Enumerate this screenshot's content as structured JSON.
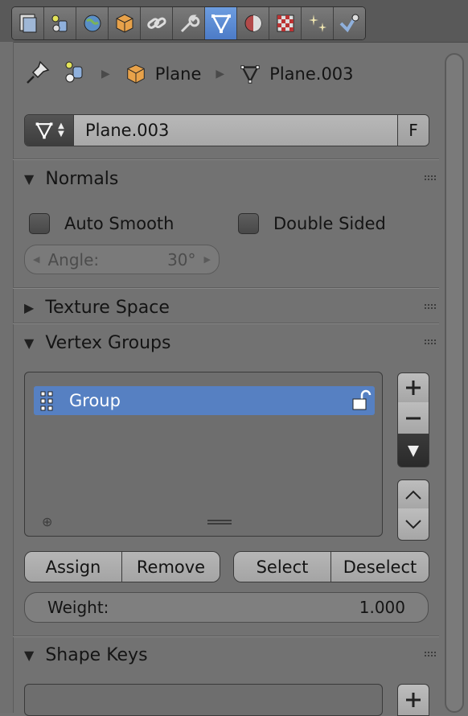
{
  "tabs": [
    {
      "icon": "render-layers-icon"
    },
    {
      "icon": "scene-icon"
    },
    {
      "icon": "world-icon"
    },
    {
      "icon": "object-icon"
    },
    {
      "icon": "constraints-icon"
    },
    {
      "icon": "modifiers-icon"
    },
    {
      "icon": "mesh-data-icon",
      "active": true
    },
    {
      "icon": "material-icon"
    },
    {
      "icon": "texture-icon"
    },
    {
      "icon": "particles-icon"
    },
    {
      "icon": "physics-icon"
    }
  ],
  "breadcrumb": {
    "object": "Plane",
    "mesh": "Plane.003"
  },
  "datablock": {
    "name": "Plane.003",
    "fake_user": "F"
  },
  "normals": {
    "title": "Normals",
    "auto_smooth": "Auto Smooth",
    "double_sided": "Double Sided",
    "angle_label": "Angle:",
    "angle_value": "30°"
  },
  "texture_space": {
    "title": "Texture Space"
  },
  "vertex_groups": {
    "title": "Vertex Groups",
    "items": [
      {
        "name": "Group"
      }
    ],
    "assign": "Assign",
    "remove": "Remove",
    "select": "Select",
    "deselect": "Deselect",
    "weight_label": "Weight:",
    "weight_value": "1.000"
  },
  "shape_keys": {
    "title": "Shape Keys"
  },
  "colors": {
    "selection": "#5680c2",
    "active_tab": "#5b8bd6"
  }
}
